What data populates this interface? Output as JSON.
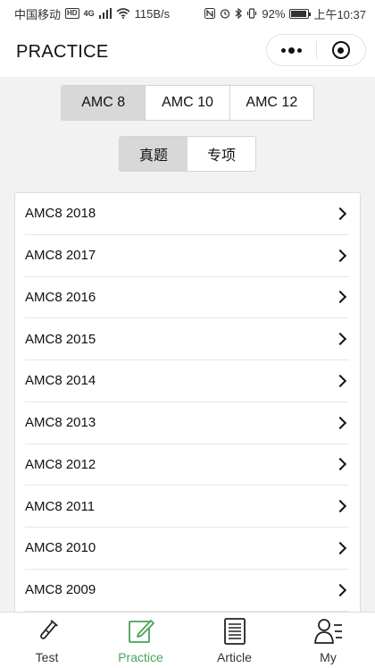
{
  "status_bar": {
    "carrier": "中国移动",
    "badge_hd": "HD",
    "network": "4G",
    "speed": "115B/s",
    "battery_percent_text": "92%",
    "battery_level": 0.92,
    "time": "上午10:37"
  },
  "header": {
    "title": "PRACTICE"
  },
  "level_tabs": [
    {
      "label": "AMC 8",
      "active": true
    },
    {
      "label": "AMC 10",
      "active": false
    },
    {
      "label": "AMC 12",
      "active": false
    }
  ],
  "type_tabs": [
    {
      "label": "真题",
      "active": true
    },
    {
      "label": "专项",
      "active": false
    }
  ],
  "exam_list": [
    {
      "label": "AMC8 2018"
    },
    {
      "label": "AMC8 2017"
    },
    {
      "label": "AMC8 2016"
    },
    {
      "label": "AMC8 2015"
    },
    {
      "label": "AMC8 2014"
    },
    {
      "label": "AMC8 2013"
    },
    {
      "label": "AMC8 2012"
    },
    {
      "label": "AMC8 2011"
    },
    {
      "label": "AMC8 2010"
    },
    {
      "label": "AMC8 2009"
    }
  ],
  "tab_bar": [
    {
      "label": "Test",
      "icon": "test-tube-icon",
      "active": false
    },
    {
      "label": "Practice",
      "icon": "edit-icon",
      "active": true
    },
    {
      "label": "Article",
      "icon": "document-icon",
      "active": false
    },
    {
      "label": "My",
      "icon": "profile-icon",
      "active": false
    }
  ],
  "colors": {
    "accent": "#4aa35a",
    "segment_active": "#d8d8d8",
    "background": "#f2f2f2"
  }
}
